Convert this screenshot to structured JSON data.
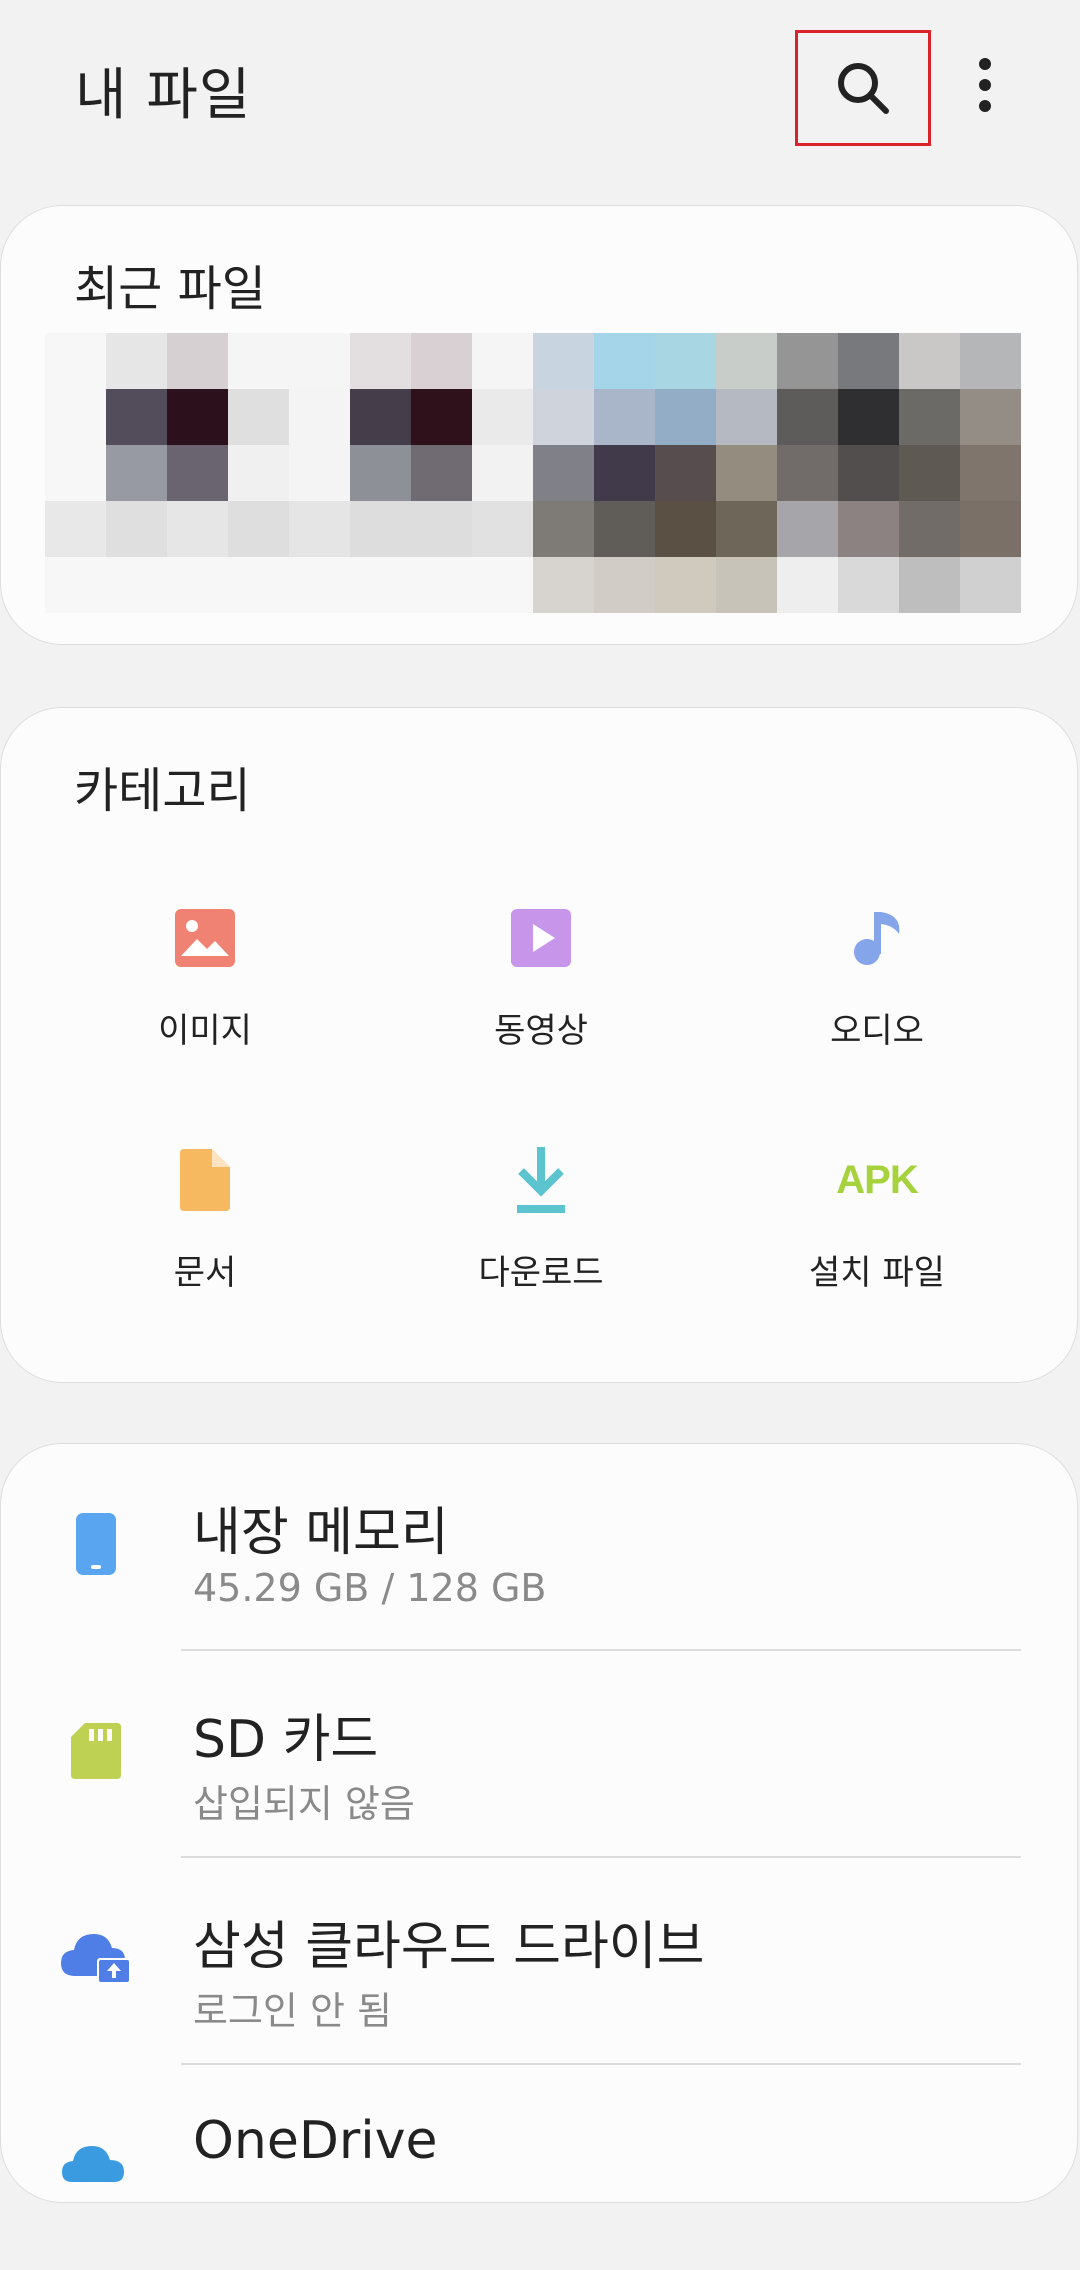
{
  "header": {
    "title": "내 파일",
    "search_icon": "search-icon",
    "more_icon": "more-vert-icon"
  },
  "recent": {
    "title": "최근 파일",
    "thumbnails": [
      [
        "#f7f7f7",
        "#e6e6e6",
        "#d7d0d2",
        "#f5f5f5",
        "#f5f5f5",
        "#e3dfe1",
        "#d9d0d3",
        "#f5f5f5",
        "#c9d4e1",
        "#a5d5e8",
        "#a8d6e3",
        "#c8cdca",
        "#959595",
        "#78797c",
        "#cac8c6",
        "#b5b6b8"
      ],
      [
        "#f7f7f7",
        "#534d5b",
        "#2c101b",
        "#dfdfdf",
        "#f4f4f4",
        "#453d4a",
        "#2e111a",
        "#eaeaea",
        "#cfd4dc",
        "#a9b5c9",
        "#93adc7",
        "#b4b9c2",
        "#5e5b5b",
        "#2f2f31",
        "#6c6a67",
        "#948d86"
      ],
      [
        "#f7f7f7",
        "#979aa2",
        "#6a6370",
        "#f0f0f0",
        "#f4f4f4",
        "#8e9098",
        "#706a72",
        "#f2f2f2",
        "#808089",
        "#403a4b",
        "#574d4e",
        "#958c80",
        "#716b6a",
        "#524e4e",
        "#5e5952",
        "#7f756c"
      ],
      [
        "#e8e8e8",
        "#dfdfdf",
        "#e6e6e6",
        "#dedede",
        "#e5e5e5",
        "#dddddd",
        "#dddddd",
        "#e1e1e1",
        "#7e7a75",
        "#605c58",
        "#5a5043",
        "#6e6658",
        "#a6a5a9",
        "#8c8282",
        "#726c69",
        "#7b7068"
      ],
      [
        "#f7f7f7",
        "#f7f7f7",
        "#f7f7f7",
        "#f7f7f7",
        "#f7f7f7",
        "#f7f7f7",
        "#f7f7f7",
        "#f7f7f7",
        "#d7d3ce",
        "#d1cdc6",
        "#cfcabd",
        "#c8c3b8",
        "#eeeeee",
        "#d9d9d9",
        "#bebebe",
        "#d0d0d0"
      ]
    ]
  },
  "categories": {
    "title": "카테고리",
    "items": [
      {
        "label": "이미지",
        "icon": "image-icon",
        "color": "#ef8273"
      },
      {
        "label": "동영상",
        "icon": "video-icon",
        "color": "#c795e9"
      },
      {
        "label": "오디오",
        "icon": "music-note-icon",
        "color": "#84a5ea"
      },
      {
        "label": "문서",
        "icon": "document-icon",
        "color": "#f6b95f"
      },
      {
        "label": "다운로드",
        "icon": "download-icon",
        "color": "#5cc4cf"
      },
      {
        "label": "설치 파일",
        "icon": "apk-icon",
        "icon_text": "APK",
        "color": "#a6d23d"
      }
    ]
  },
  "storage": {
    "items": [
      {
        "title": "내장 메모리",
        "subtitle": "45.29 GB / 128 GB",
        "icon": "phone-icon",
        "color": "#5aa5f0"
      },
      {
        "title": "SD 카드",
        "subtitle": "삽입되지 않음",
        "icon": "sd-card-icon",
        "color": "#bfd152"
      },
      {
        "title": "삼성 클라우드 드라이브",
        "subtitle": "로그인 안 됨",
        "icon": "cloud-upload-icon",
        "color": "#4f7ee6"
      },
      {
        "title": "OneDrive",
        "subtitle": "",
        "icon": "onedrive-icon",
        "color": "#3a9be0"
      }
    ]
  }
}
